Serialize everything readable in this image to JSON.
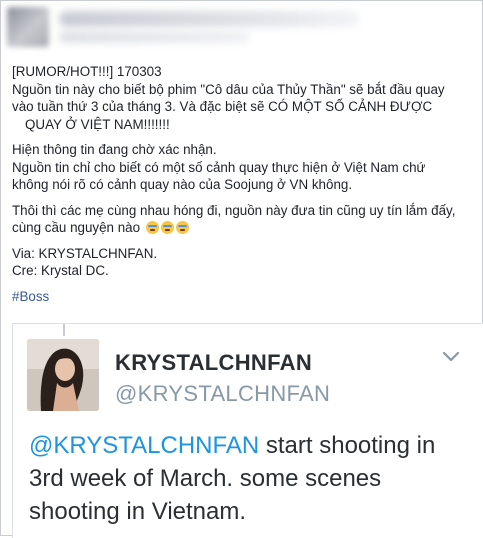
{
  "post": {
    "line1": "[RUMOR/HOT!!!] 170303",
    "line2": "Nguồn tin này cho biết bộ phim \"Cô dâu của Thủy Thần\" sẽ bắt đầu quay",
    "line3": "vào tuần thứ 3 của tháng 3. Và đặc biệt sẽ CÓ MỘT SỐ CẢNH ĐƯỢC",
    "line4": "QUAY Ở VIỆT NAM!!!!!!!",
    "line5": "Hiện thông tin đang chờ xác nhận.",
    "line6": "Nguồn tin chỉ cho biết có một số cảnh quay thực hiện ở Việt Nam chứ",
    "line7": "không nói rõ có cảnh quay nào của Soojung ở VN không.",
    "line8": "Thôi thì các mẹ cùng nhau hóng đi, nguồn này đưa tin cũng uy tín lắm đấy,",
    "line9": "cùng cầu nguyện nào",
    "via": "Via: KRYSTALCHNFAN.",
    "cre": "Cre: Krystal DC.",
    "hashtag": "#Boss"
  },
  "tweet": {
    "display_name": "KRYSTALCHNFAN",
    "handle": "@KRYSTALCHNFAN",
    "mention": "@KRYSTALCHNFAN",
    "text_rest": " start shooting in 3rd week of March. some scenes shooting in Vietnam."
  },
  "icons": {
    "emoji": "crying-face-emoji",
    "menu": "chevron-down-icon"
  },
  "colors": {
    "link": "#365899",
    "mention": "#1b95e0",
    "tweet_text": "#292f33",
    "handle": "#8899a6"
  }
}
